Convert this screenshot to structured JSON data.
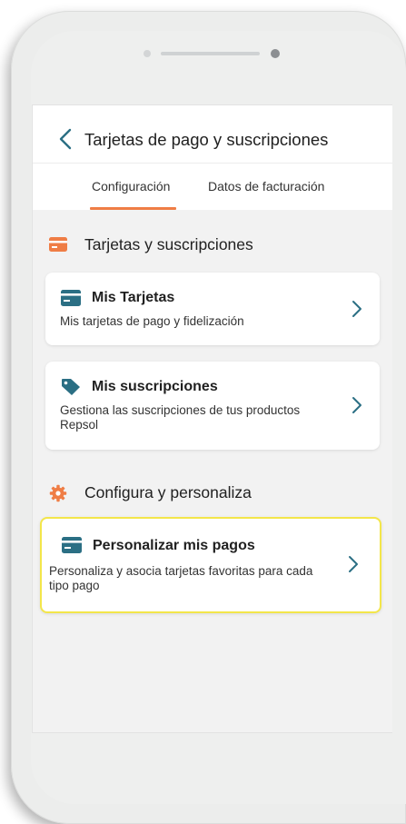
{
  "header": {
    "title": "Tarjetas de pago y suscripciones"
  },
  "tabs": {
    "configuracion": "Configuración",
    "facturacion": "Datos de facturación"
  },
  "sections": {
    "tarjetas": "Tarjetas y suscripciones",
    "configura": "Configura y personaliza"
  },
  "cards": {
    "mis_tarjetas": {
      "title": "Mis Tarjetas",
      "desc": "Mis tarjetas de pago y fidelización"
    },
    "mis_suscripciones": {
      "title": "Mis suscripciones",
      "desc": "Gestiona las suscripciones de tus productos Repsol"
    },
    "personalizar": {
      "title": "Personalizar mis pagos",
      "desc": "Personaliza y asocia tarjetas favoritas para cada tipo pago"
    }
  },
  "colors": {
    "accent": "#ef7d45",
    "icon_teal": "#2b6f84",
    "highlight": "#f3e64a"
  },
  "icons": {
    "back": "chevron-left-icon",
    "card": "credit-card-icon",
    "tag": "tag-icon",
    "gear": "gear-icon",
    "chevron": "chevron-right-icon"
  }
}
